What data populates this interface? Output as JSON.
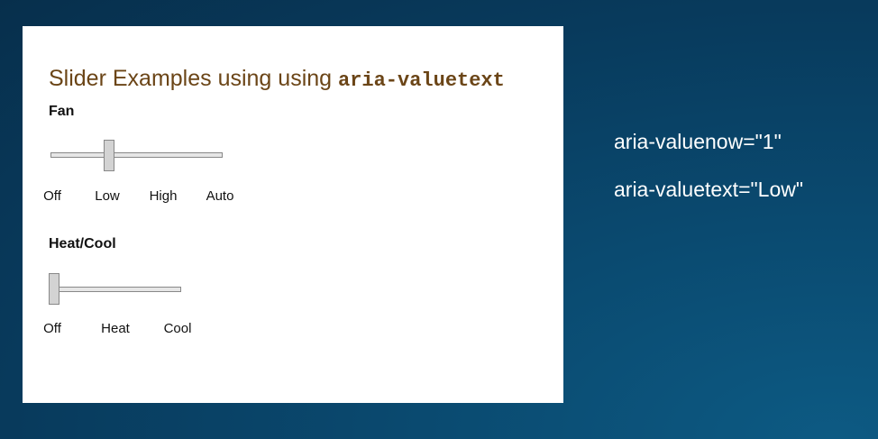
{
  "panel": {
    "title_prefix": "Slider Examples using using ",
    "title_code": "aria-valuetext"
  },
  "sliders": [
    {
      "label": "Fan",
      "ticks": [
        "Off",
        "Low",
        "High",
        "Auto"
      ],
      "value_index": 1
    },
    {
      "label": "Heat/Cool",
      "ticks": [
        "Off",
        "Heat",
        "Cool"
      ],
      "value_index": 0
    }
  ],
  "aria_info": {
    "valuenow": "aria-valuenow=\"1\"",
    "valuetext": "aria-valuetext=\"Low\""
  },
  "colors": {
    "background": "#083a5c",
    "title": "#6b4517",
    "info_text": "#ffffff"
  }
}
